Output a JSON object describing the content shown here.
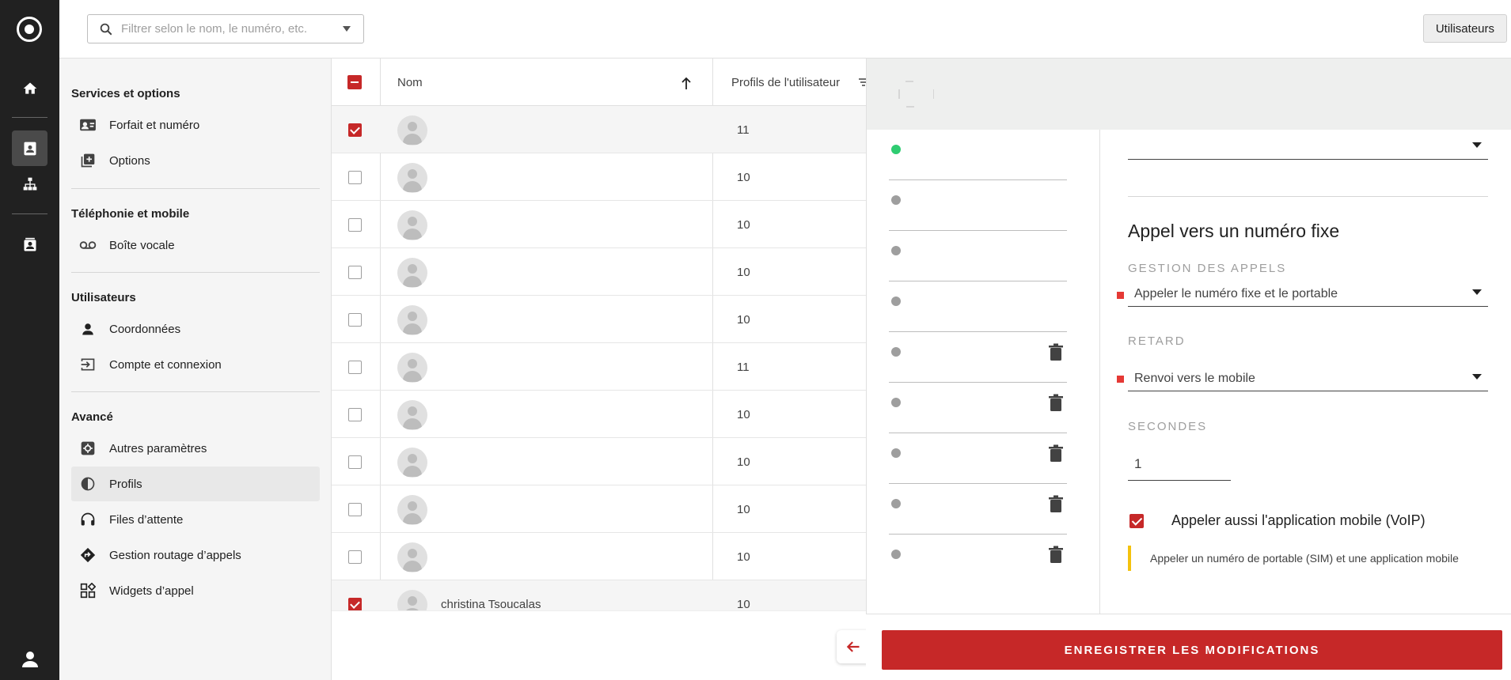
{
  "search": {
    "placeholder": "Filtrer selon le nom, le numéro, etc."
  },
  "header": {
    "users_button": "Utilisateurs"
  },
  "menu": {
    "sections": [
      {
        "title": "Services et options",
        "items": [
          "Forfait et numéro",
          "Options"
        ]
      },
      {
        "title": "Téléphonie et mobile",
        "items": [
          "Boîte vocale"
        ]
      },
      {
        "title": "Utilisateurs",
        "items": [
          "Coordonnées",
          "Compte et connexion"
        ]
      },
      {
        "title": "Avancé",
        "items": [
          "Autres paramètres",
          "Profils",
          "Files d’attente",
          "Gestion routage d’appels",
          "Widgets d’appel"
        ]
      }
    ],
    "active_item": "Profils"
  },
  "table": {
    "columns": [
      "Nom",
      "Profils de l'utilisateur"
    ],
    "rows": [
      {
        "name": "",
        "profiles": "11",
        "checked": true
      },
      {
        "name": "",
        "profiles": "10",
        "checked": false
      },
      {
        "name": "",
        "profiles": "10",
        "checked": false
      },
      {
        "name": "",
        "profiles": "10",
        "checked": false
      },
      {
        "name": "",
        "profiles": "10",
        "checked": false
      },
      {
        "name": "",
        "profiles": "11",
        "checked": false
      },
      {
        "name": "",
        "profiles": "10",
        "checked": false
      },
      {
        "name": "",
        "profiles": "10",
        "checked": false
      },
      {
        "name": "",
        "profiles": "10",
        "checked": false
      },
      {
        "name": "",
        "profiles": "10",
        "checked": false
      },
      {
        "name": "christina Tsoucalas",
        "profiles": "10",
        "checked": true
      }
    ]
  },
  "panel": {
    "section_title": "Appel vers un numéro fixe",
    "call_management_label": "Gestion des appels",
    "call_management_value": "Appeler le numéro fixe et le portable",
    "delay_label": "Retard",
    "delay_value": "Renvoi vers le mobile",
    "seconds_label": "Secondes",
    "seconds_value": "1",
    "voip_label": "Appeler aussi l'application mobile (VoIP)",
    "hint": "Appeler un numéro de portable (SIM) et une application mobile",
    "save_button": "ENREGISTRER LES MODIFICATIONS"
  },
  "colors": {
    "accent": "#c62828",
    "rail": "#212121",
    "status_active": "#2ecc71",
    "hint_bar": "#f4c20d"
  }
}
